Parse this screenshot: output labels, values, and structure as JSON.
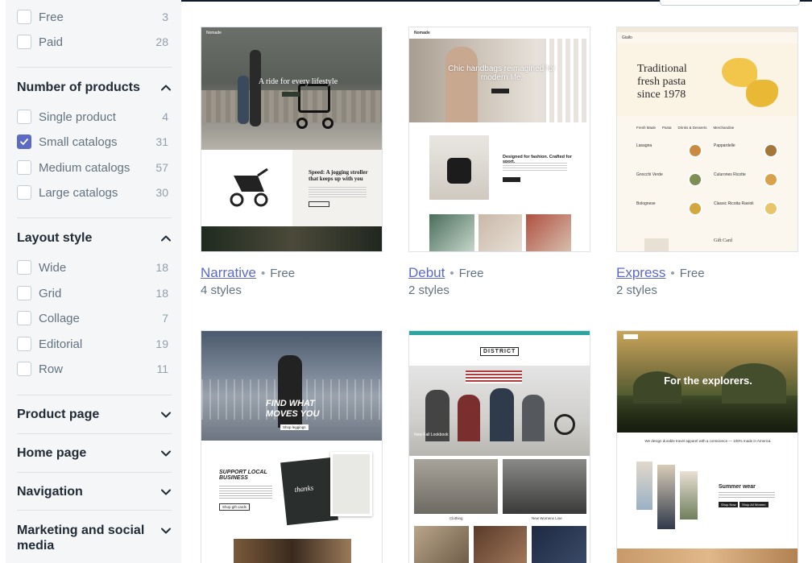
{
  "sidebar": {
    "price_filters": [
      {
        "label": "Free",
        "count": "3",
        "checked": false
      },
      {
        "label": "Paid",
        "count": "28",
        "checked": false
      }
    ],
    "number_of_products": {
      "title": "Number of products",
      "items": [
        {
          "label": "Single product",
          "count": "4",
          "checked": false
        },
        {
          "label": "Small catalogs",
          "count": "31",
          "checked": true
        },
        {
          "label": "Medium catalogs",
          "count": "57",
          "checked": false
        },
        {
          "label": "Large catalogs",
          "count": "30",
          "checked": false
        }
      ]
    },
    "layout_style": {
      "title": "Layout style",
      "items": [
        {
          "label": "Wide",
          "count": "18",
          "checked": false
        },
        {
          "label": "Grid",
          "count": "18",
          "checked": false
        },
        {
          "label": "Collage",
          "count": "7",
          "checked": false
        },
        {
          "label": "Editorial",
          "count": "19",
          "checked": false
        },
        {
          "label": "Row",
          "count": "11",
          "checked": false
        }
      ]
    },
    "collapsed_sections": [
      "Product page",
      "Home page",
      "Navigation",
      "Marketing and social media"
    ]
  },
  "themes": [
    {
      "name": "Narrative",
      "price": "Free",
      "styles": "4 styles",
      "preview": {
        "brand": "Nomade",
        "hero": "A ride for every lifestyle",
        "feature_title": "Speed: A jogging stroller that keeps up with you"
      }
    },
    {
      "name": "Debut",
      "price": "Free",
      "styles": "2 styles",
      "preview": {
        "brand": "Nomade",
        "hero": "Chic handbags reimagined for modern life.",
        "feature_title": "Designed for fashion. Crafted for sport."
      }
    },
    {
      "name": "Express",
      "price": "Free",
      "styles": "2 styles",
      "preview": {
        "brand": "Giallo",
        "hero": "Traditional fresh pasta since 1978",
        "tabs": [
          "Fresh Made",
          "Pasta",
          "Drinks & Desserts",
          "Merchandise"
        ],
        "menu": [
          "Lasagna",
          "Pappardelle",
          "Gnocchi Verde",
          "Culurones Ricotte",
          "Bolognese",
          "Classic Ricotta Ravioli"
        ],
        "footer": "Gift Card"
      }
    },
    {
      "name": "",
      "price": "",
      "styles": "",
      "preview": {
        "hero": "FIND WHAT MOVES YOU",
        "cta": "Shop leggings",
        "feature_title": "SUPPORT LOCAL BUSINESS",
        "feature_cta": "Shop gift cards",
        "card_script": "thanks"
      }
    },
    {
      "name": "",
      "price": "",
      "styles": "",
      "preview": {
        "brand": "DISTRICT",
        "hero_caption": "New Fall Lookbook",
        "tiles": [
          "Clothing",
          "New Womens Line"
        ]
      }
    },
    {
      "name": "",
      "price": "",
      "styles": "",
      "preview": {
        "hero": "For the explorers.",
        "tagline": "We design durable travel apparel with a conscience — 100% made in America.",
        "feature_title": "Summer wear",
        "btns": [
          "Shop Now",
          "Shop All Women"
        ]
      }
    }
  ],
  "colors": {
    "accent": "#5c6ac4",
    "sidebar_bg": "#f4f6f8",
    "text_muted": "#637381"
  }
}
